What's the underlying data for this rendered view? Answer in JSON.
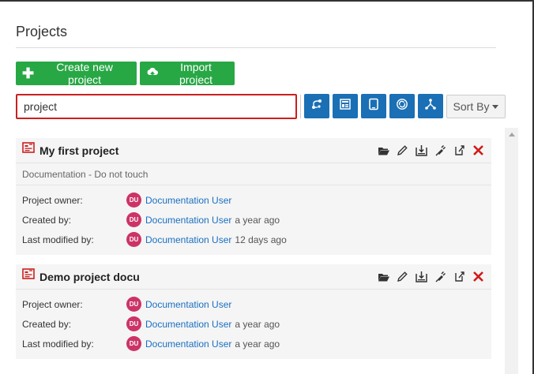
{
  "header": {
    "title": "Projects"
  },
  "actions": {
    "create_label": "Create new project",
    "import_label": "Import project"
  },
  "search": {
    "value": "project"
  },
  "toolbar": {
    "sort_label": "Sort By",
    "buttons": [
      "git-icon",
      "dashboard-icon",
      "tablet-icon",
      "sync-icon",
      "network-icon"
    ]
  },
  "colors": {
    "accent": "#1b6fb5",
    "create": "#28a745",
    "danger": "#cc1f1f",
    "avatar": "#cc3366"
  },
  "projects": [
    {
      "name": "My first project",
      "description": "Documentation - Do not touch",
      "owner_label": "Project owner:",
      "owner": "Documentation User",
      "owner_initials": "DU",
      "created_label": "Created by:",
      "created_by": "Documentation User",
      "created_initials": "DU",
      "created_ago": "a year ago",
      "modified_label": "Last modified by:",
      "modified_by": "Documentation User",
      "modified_initials": "DU",
      "modified_ago": "12 days ago"
    },
    {
      "name": "Demo project docu",
      "owner_label": "Project owner:",
      "owner": "Documentation User",
      "owner_initials": "DU",
      "created_label": "Created by:",
      "created_by": "Documentation User",
      "created_initials": "DU",
      "created_ago": "a year ago",
      "modified_label": "Last modified by:",
      "modified_by": "Documentation User",
      "modified_initials": "DU",
      "modified_ago": "a year ago"
    }
  ]
}
